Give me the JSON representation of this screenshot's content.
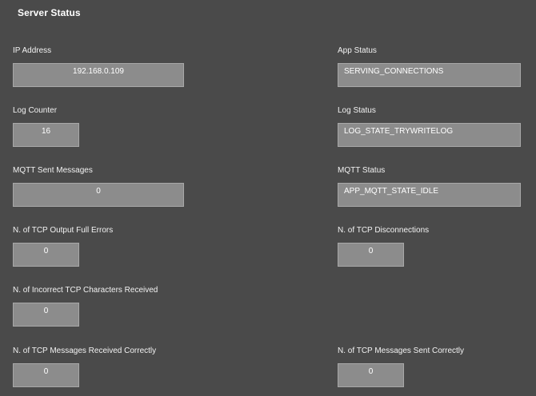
{
  "header": {
    "title": "Server Status"
  },
  "fields": {
    "ip_address": {
      "label": "IP Address",
      "value": "192.168.0.109"
    },
    "app_status": {
      "label": "App Status",
      "value": "SERVING_CONNECTIONS"
    },
    "log_counter": {
      "label": "Log Counter",
      "value": "16"
    },
    "log_status": {
      "label": "Log Status",
      "value": "LOG_STATE_TRYWRITELOG"
    },
    "mqtt_sent": {
      "label": "MQTT Sent Messages",
      "value": "0"
    },
    "mqtt_status": {
      "label": "MQTT Status",
      "value": "APP_MQTT_STATE_IDLE"
    },
    "tcp_output_full_errors": {
      "label": "N. of TCP Output Full Errors",
      "value": "0"
    },
    "tcp_disconnections": {
      "label": "N. of TCP Disconnections",
      "value": "0"
    },
    "tcp_incorrect_chars": {
      "label": "N. of Incorrect TCP Characters Received",
      "value": "0"
    },
    "tcp_msgs_received": {
      "label": "N. of TCP Messages Received Correctly",
      "value": "0"
    },
    "tcp_msgs_sent": {
      "label": "N. of TCP Messages Sent Correctly",
      "value": "0"
    }
  }
}
